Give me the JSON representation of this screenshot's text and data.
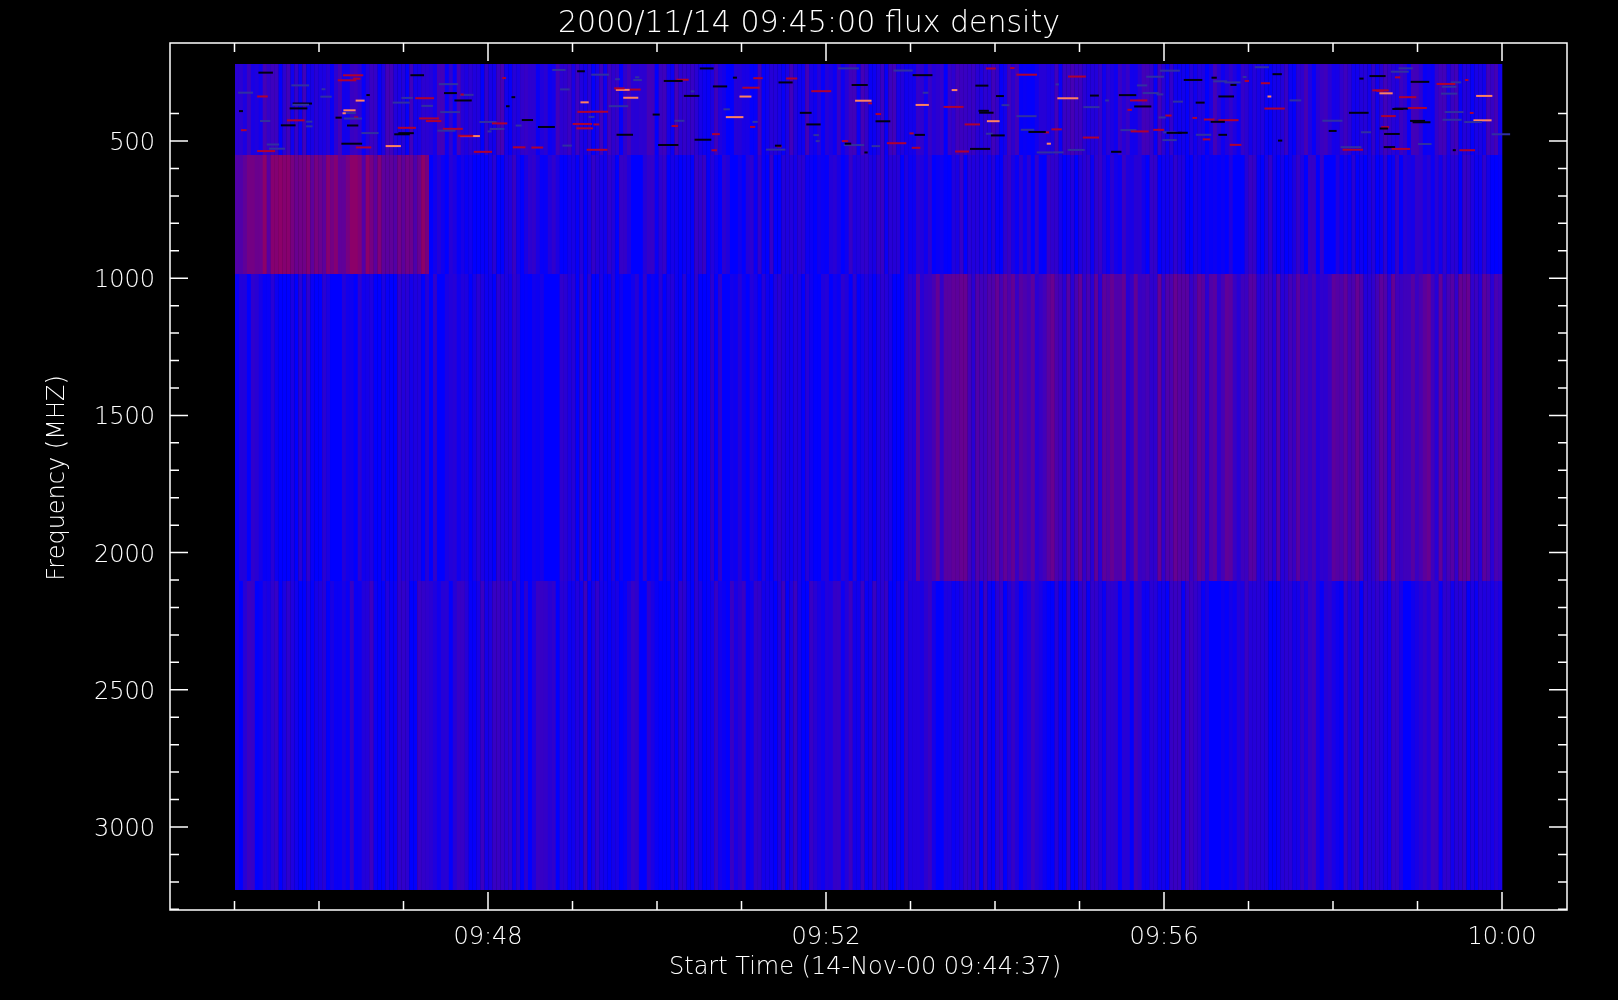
{
  "title": "2000/11/14 09:45:00 flux density",
  "y_axis": {
    "label": "Frequency (MHZ)",
    "ticks": [
      "500",
      "1000",
      "1500",
      "2000",
      "2500",
      "3000"
    ]
  },
  "x_axis": {
    "label": "Start Time (14-Nov-00 09:44:37)",
    "ticks": [
      "09:48",
      "09:52",
      "09:56",
      "10:00"
    ]
  }
}
